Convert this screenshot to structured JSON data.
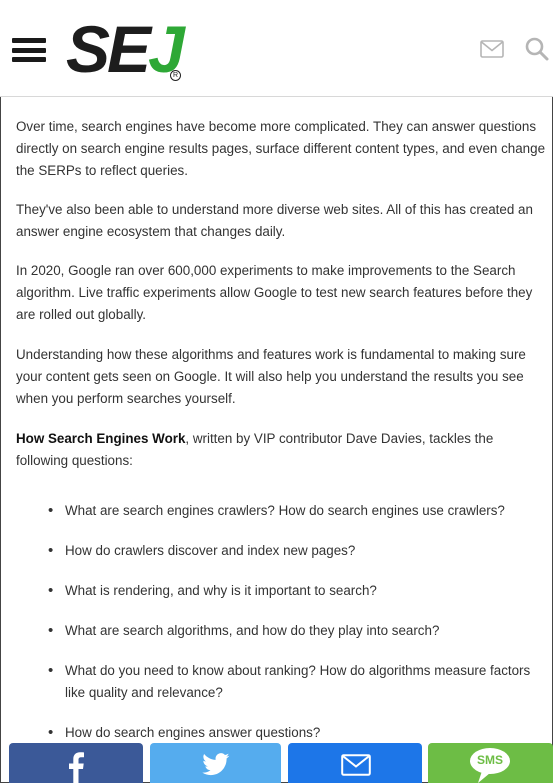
{
  "header": {
    "logo_text": {
      "s": "S",
      "e": "E",
      "j": "J",
      "reg": "R"
    },
    "icons": [
      "hamburger-menu-icon",
      "mail-icon",
      "search-icon"
    ]
  },
  "article": {
    "paragraphs": [
      "Over time, search engines have become more complicated. They can answer questions directly on search engine results pages, surface different content types, and even change the SERPs to reflect queries.",
      "They've also been able to understand more diverse web sites. All of this has created an answer engine ecosystem that changes daily.",
      "In 2020, Google ran over 600,000 experiments to make improvements to the Search algorithm. Live traffic experiments allow Google to test new search features before they are rolled out globally.",
      "Understanding how these algorithms and features work is fundamental to making sure your content gets seen on Google. It will also help you understand the results you see when you perform searches yourself."
    ],
    "intro_bold": "How Search Engines Work",
    "intro_rest": ", written by VIP contributor Dave Davies, tackles the following questions:",
    "bullets": [
      "What are search engines crawlers? How do search engines use crawlers?",
      "How do crawlers discover and index new pages?",
      "What is rendering, and why is it important to search?",
      "What are search algorithms, and how do they play into search?",
      "What do you need to know about ranking? How do algorithms measure factors like quality and relevance?",
      "How do search engines answer questions?"
    ]
  },
  "share_bar": {
    "facebook_label": "f",
    "sms_label": "SMS",
    "colors": {
      "facebook": "#3b5998",
      "twitter": "#55acee",
      "email": "#1d76e8",
      "sms": "#6dbd45"
    }
  },
  "colors": {
    "brand_green": "#2ea836",
    "text": "#333333"
  }
}
